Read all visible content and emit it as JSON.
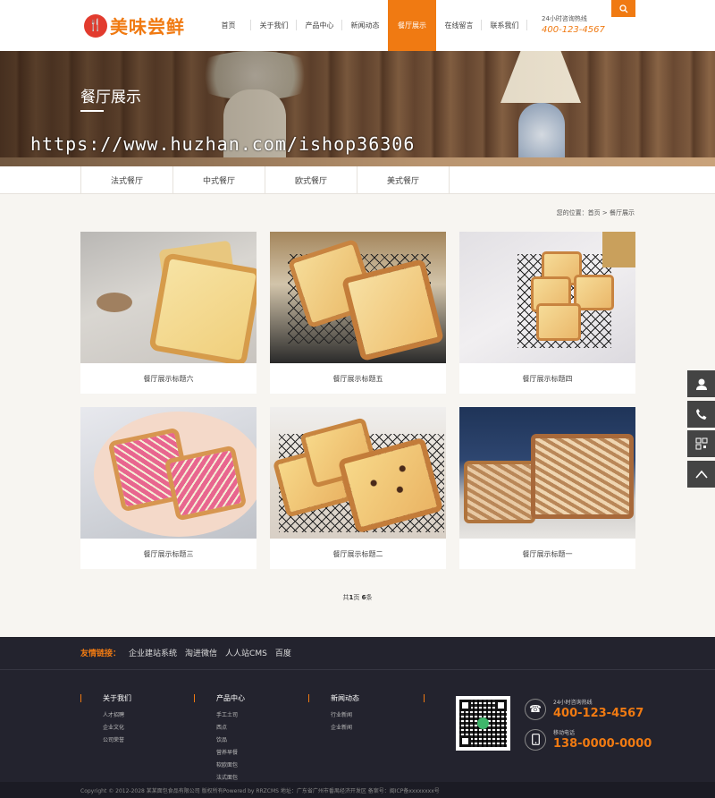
{
  "header": {
    "logo_text": "美味尝鲜",
    "nav": [
      "首页",
      "关于我们",
      "产品中心",
      "新闻动态",
      "餐厅展示",
      "在线留言",
      "联系我们"
    ],
    "active_nav": "餐厅展示",
    "hotline_label": "24小时咨询热线",
    "hotline_number": "400-123-4567",
    "search_icon": "search-icon"
  },
  "banner": {
    "title": "餐厅展示",
    "watermark": "https://www.huzhan.com/ishop36306"
  },
  "subnav": [
    "法式餐厅",
    "中式餐厅",
    "欧式餐厅",
    "美式餐厅"
  ],
  "breadcrumb": {
    "prefix": "您的位置：",
    "home": "首页",
    "sep": ">",
    "current": "餐厅展示"
  },
  "cards": [
    {
      "title": "餐厅展示标题六"
    },
    {
      "title": "餐厅展示标题五"
    },
    {
      "title": "餐厅展示标题四"
    },
    {
      "title": "餐厅展示标题三"
    },
    {
      "title": "餐厅展示标题二"
    },
    {
      "title": "餐厅展示标题一"
    }
  ],
  "pagination": {
    "prefix": "共",
    "pages": "1",
    "mid": "页 ",
    "count": "6",
    "suffix": "条"
  },
  "side_tools": [
    "service-icon",
    "phone-icon",
    "qrcode-icon",
    "back-to-top-icon"
  ],
  "footer": {
    "links_title": "友情链接：",
    "links": [
      "企业建站系统",
      "淘进微信",
      "人人站CMS",
      "百度"
    ],
    "columns": [
      {
        "title": "关于我们",
        "items": [
          "人才招聘",
          "企业文化",
          "公司荣誉"
        ]
      },
      {
        "title": "产品中心",
        "items": [
          "手工土司",
          "西点",
          "饮品",
          "营养早餐",
          "软欧面包",
          "法式面包"
        ]
      },
      {
        "title": "新闻动态",
        "items": [
          "行业新闻",
          "企业新闻"
        ]
      }
    ],
    "contacts": [
      {
        "label": "24小时咨询热线",
        "number": "400-123-4567",
        "icon": "telephone-icon"
      },
      {
        "label": "移动电话",
        "number": "138-0000-0000",
        "icon": "mobile-icon"
      }
    ],
    "copyright": "Copyright © 2012-2028 某某面包食品有限公司 版权所有Powered by RRZCMS   地址：广东省广州市番禺经济开发区   备案号：闽ICP备xxxxxxxx号"
  },
  "colors": {
    "accent": "#f07a12",
    "footer_bg": "#23232e"
  }
}
